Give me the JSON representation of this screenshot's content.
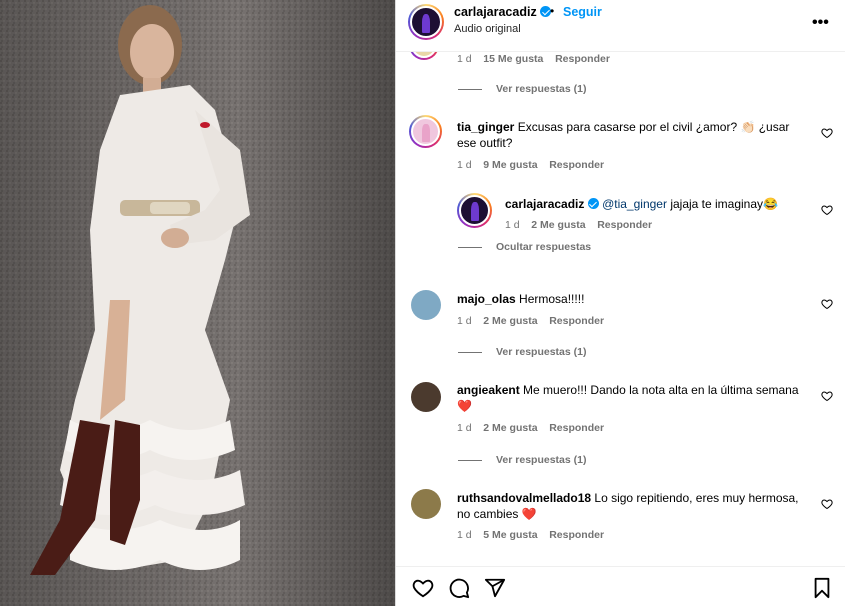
{
  "header": {
    "username": "carlajaracadiz",
    "separator": "•",
    "follow_label": "Seguir",
    "subtitle": "Audio original",
    "more_label": "•••"
  },
  "comments": [
    {
      "id": "c0",
      "meta": {
        "time": "1 d",
        "likes": "15 Me gusta",
        "reply": "Responder"
      },
      "view_replies": "Ver respuestas (1)"
    },
    {
      "id": "c1",
      "username": "tia_ginger",
      "text": "Excusas para casarse por el civil ¿amor? 👏🏻 ¿usar ese outfit?",
      "meta": {
        "time": "1 d",
        "likes": "9 Me gusta",
        "reply": "Responder"
      }
    },
    {
      "id": "c1r",
      "username": "carlajaracadiz",
      "mention": "@tia_ginger",
      "text": "jajaja te imaginay😂",
      "meta": {
        "time": "1 d",
        "likes": "2 Me gusta",
        "reply": "Responder"
      },
      "hide_replies": "Ocultar respuestas"
    },
    {
      "id": "c2",
      "username": "majo_olas",
      "text": "Hermosa!!!!!",
      "meta": {
        "time": "1 d",
        "likes": "2 Me gusta",
        "reply": "Responder"
      },
      "view_replies": "Ver respuestas (1)"
    },
    {
      "id": "c3",
      "username": "angieakent",
      "text": "Me muero!!! Dando la nota alta en la última semana ❤️",
      "meta": {
        "time": "1 d",
        "likes": "2 Me gusta",
        "reply": "Responder"
      },
      "view_replies": "Ver respuestas (1)"
    },
    {
      "id": "c4",
      "username": "ruthsandovalmellado18",
      "text": "Lo sigo repitiendo, eres muy hermosa, no cambies ❤️",
      "meta": {
        "time": "1 d",
        "likes": "5 Me gusta",
        "reply": "Responder"
      }
    }
  ],
  "footer": {
    "icons": [
      "heart-icon",
      "comment-icon",
      "share-icon",
      "bookmark-icon"
    ]
  },
  "colors": {
    "accent": "#0095f6",
    "secondary_text": "#737373",
    "mention": "#00376b",
    "heart": "#e0245e"
  }
}
